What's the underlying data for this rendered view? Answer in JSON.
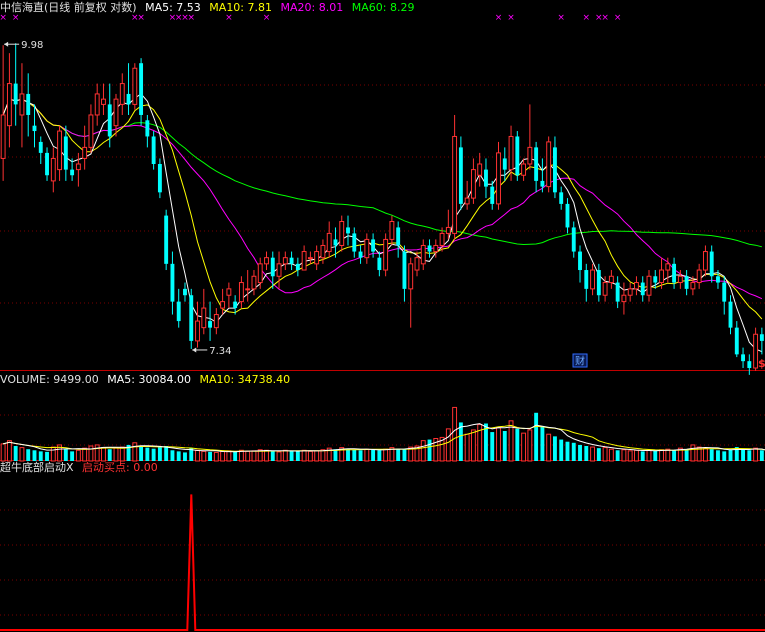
{
  "header": {
    "title": "中信海直(日线 前复权 对数)",
    "ma5": "MA5: 7.53",
    "ma10": "MA10: 7.81",
    "ma20": "MA20: 8.01",
    "ma60": "MA60: 8.29"
  },
  "volume_header": {
    "label": "VOLUME: 9499.00",
    "ma5": "MA5: 30084.00",
    "ma10": "MA10: 34738.40"
  },
  "indicator_header": {
    "name": "超牛底部启动X",
    "value": "启动买点: 0.00"
  },
  "colors": {
    "up": "#ff3232",
    "down": "#00ffff",
    "ma5": "#ffffff",
    "ma10": "#ffff00",
    "ma20": "#ff00ff",
    "ma60": "#00ff00",
    "grid": "#7a0000",
    "axis": "#c00000",
    "signal": "#ff0000"
  },
  "icons": {
    "x_marks": "magenta-x-icon",
    "finance_badge": "财",
    "dividend_badge": "$"
  },
  "chart_data": [
    {
      "type": "candlestick",
      "title": "中信海直(日线 前复权 对数)",
      "log_scale": true,
      "ylim": [
        7.2,
        10.3
      ],
      "annotations": [
        {
          "text": "9.98",
          "candle_index": 0,
          "value": 9.98,
          "kind": "high"
        },
        {
          "text": "7.34",
          "candle_index": 30,
          "value": 7.34,
          "kind": "low"
        }
      ],
      "x_mark_candles": [
        0,
        2,
        21,
        22,
        27,
        28,
        29,
        30,
        36,
        42,
        79,
        81,
        89,
        93,
        95,
        96,
        98
      ],
      "finance_badge_candle": 92,
      "dividend_badge_candle": 121,
      "candles": [
        [
          8.9,
          9.3,
          9.98,
          8.7
        ],
        [
          9.2,
          9.6,
          9.9,
          9.0
        ],
        [
          9.6,
          9.4,
          10.0,
          9.2
        ],
        [
          9.3,
          9.5,
          9.8,
          9.0
        ],
        [
          9.5,
          9.3,
          9.7,
          9.1
        ],
        [
          9.2,
          9.15,
          9.4,
          9.0
        ],
        [
          9.05,
          8.95,
          9.1,
          8.85
        ],
        [
          8.95,
          8.75,
          9.0,
          8.7
        ],
        [
          8.7,
          8.9,
          9.0,
          8.6
        ],
        [
          8.8,
          9.15,
          9.2,
          8.7
        ],
        [
          9.1,
          8.8,
          9.2,
          8.7
        ],
        [
          8.8,
          8.75,
          8.9,
          8.7
        ],
        [
          8.8,
          8.85,
          8.95,
          8.65
        ],
        [
          8.9,
          9.0,
          9.2,
          8.8
        ],
        [
          9.0,
          9.3,
          9.4,
          8.95
        ],
        [
          9.3,
          9.5,
          9.6,
          9.2
        ],
        [
          9.4,
          9.45,
          9.6,
          9.3
        ],
        [
          9.4,
          9.1,
          9.6,
          9.0
        ],
        [
          9.2,
          9.45,
          9.5,
          9.1
        ],
        [
          9.4,
          9.6,
          9.7,
          9.3
        ],
        [
          9.5,
          9.4,
          9.8,
          9.3
        ],
        [
          9.4,
          9.75,
          9.8,
          9.35
        ],
        [
          9.8,
          9.3,
          9.85,
          9.2
        ],
        [
          9.25,
          9.1,
          9.3,
          9.0
        ],
        [
          9.1,
          8.85,
          9.15,
          8.8
        ],
        [
          8.85,
          8.6,
          8.9,
          8.55
        ],
        [
          8.4,
          8.0,
          8.45,
          7.95
        ],
        [
          8.0,
          7.7,
          8.1,
          7.6
        ],
        [
          7.7,
          7.55,
          7.8,
          7.5
        ],
        [
          7.8,
          7.75,
          7.85,
          7.7
        ],
        [
          7.75,
          7.4,
          7.8,
          7.34
        ],
        [
          7.4,
          7.55,
          7.7,
          7.35
        ],
        [
          7.5,
          7.65,
          7.8,
          7.45
        ],
        [
          7.55,
          7.5,
          7.7,
          7.4
        ],
        [
          7.5,
          7.6,
          7.65,
          7.45
        ],
        [
          7.65,
          7.7,
          7.8,
          7.6
        ],
        [
          7.75,
          7.8,
          7.85,
          7.65
        ],
        [
          7.7,
          7.65,
          7.75,
          7.6
        ],
        [
          7.7,
          7.85,
          7.9,
          7.65
        ],
        [
          7.8,
          7.8,
          7.95,
          7.7
        ],
        [
          7.8,
          7.9,
          7.95,
          7.75
        ],
        [
          7.85,
          8.0,
          8.05,
          7.8
        ],
        [
          8.0,
          8.05,
          8.1,
          7.95
        ],
        [
          8.05,
          7.9,
          8.1,
          7.8
        ],
        [
          7.9,
          8.0,
          8.1,
          7.8
        ],
        [
          8.0,
          8.05,
          8.1,
          7.95
        ],
        [
          8.05,
          8.0,
          8.1,
          7.95
        ],
        [
          8.0,
          7.95,
          8.05,
          7.9
        ],
        [
          7.95,
          8.1,
          8.15,
          7.95
        ],
        [
          8.05,
          8.05,
          8.1,
          8.0
        ],
        [
          8.0,
          8.1,
          8.15,
          7.95
        ],
        [
          8.05,
          8.15,
          8.2,
          8.0
        ],
        [
          8.1,
          8.25,
          8.35,
          8.05
        ],
        [
          8.2,
          8.15,
          8.3,
          8.05
        ],
        [
          8.15,
          8.35,
          8.4,
          8.1
        ],
        [
          8.3,
          8.25,
          8.4,
          8.15
        ],
        [
          8.25,
          8.1,
          8.3,
          8.05
        ],
        [
          8.1,
          8.05,
          8.15,
          8.0
        ],
        [
          8.05,
          8.2,
          8.25,
          8.0
        ],
        [
          8.2,
          8.1,
          8.25,
          8.05
        ],
        [
          8.05,
          7.95,
          8.1,
          7.9
        ],
        [
          7.95,
          8.2,
          8.25,
          7.9
        ],
        [
          8.2,
          8.35,
          8.4,
          8.15
        ],
        [
          8.3,
          8.15,
          8.35,
          8.05
        ],
        [
          8.1,
          7.8,
          8.15,
          7.7
        ],
        [
          7.8,
          8.0,
          8.05,
          7.5
        ],
        [
          7.95,
          8.05,
          8.1,
          7.9
        ],
        [
          8.0,
          8.15,
          8.2,
          7.95
        ],
        [
          8.15,
          8.1,
          8.2,
          8.05
        ],
        [
          8.1,
          8.15,
          8.2,
          8.05
        ],
        [
          8.15,
          8.25,
          8.3,
          8.1
        ],
        [
          8.25,
          8.3,
          8.45,
          8.2
        ],
        [
          8.25,
          9.1,
          9.3,
          8.2
        ],
        [
          9.0,
          8.5,
          9.1,
          8.45
        ],
        [
          8.5,
          8.55,
          8.7,
          8.45
        ],
        [
          8.55,
          8.8,
          8.9,
          8.5
        ],
        [
          8.75,
          8.85,
          8.95,
          8.65
        ],
        [
          8.8,
          8.65,
          8.9,
          8.55
        ],
        [
          8.65,
          8.5,
          8.7,
          8.45
        ],
        [
          8.5,
          8.95,
          9.05,
          8.45
        ],
        [
          8.9,
          8.8,
          9.0,
          8.7
        ],
        [
          8.8,
          9.1,
          9.2,
          8.7
        ],
        [
          9.1,
          8.75,
          9.15,
          8.7
        ],
        [
          8.75,
          8.85,
          8.9,
          8.7
        ],
        [
          8.85,
          9.0,
          9.4,
          8.8
        ],
        [
          9.0,
          8.7,
          9.05,
          8.6
        ],
        [
          8.7,
          8.65,
          8.9,
          8.6
        ],
        [
          8.65,
          9.05,
          9.1,
          8.6
        ],
        [
          9.0,
          8.6,
          9.1,
          8.55
        ],
        [
          8.6,
          8.5,
          8.65,
          8.45
        ],
        [
          8.5,
          8.3,
          8.55,
          8.25
        ],
        [
          8.3,
          8.1,
          8.35,
          8.05
        ],
        [
          8.1,
          7.95,
          8.15,
          7.85
        ],
        [
          7.95,
          7.8,
          8.0,
          7.7
        ],
        [
          7.8,
          7.95,
          8.0,
          7.75
        ],
        [
          7.95,
          7.75,
          8.0,
          7.7
        ],
        [
          7.75,
          7.85,
          7.9,
          7.7
        ],
        [
          7.85,
          7.9,
          7.95,
          7.8
        ],
        [
          7.85,
          7.7,
          7.9,
          7.65
        ],
        [
          7.7,
          7.75,
          7.85,
          7.6
        ],
        [
          7.75,
          7.8,
          7.85,
          7.7
        ],
        [
          7.8,
          7.85,
          7.9,
          7.75
        ],
        [
          7.85,
          7.75,
          7.9,
          7.7
        ],
        [
          7.75,
          7.9,
          7.95,
          7.7
        ],
        [
          7.9,
          7.85,
          7.95,
          7.8
        ],
        [
          7.85,
          7.95,
          8.05,
          7.8
        ],
        [
          7.95,
          8.0,
          8.05,
          7.85
        ],
        [
          8.0,
          7.85,
          8.05,
          7.8
        ],
        [
          7.85,
          7.9,
          7.95,
          7.8
        ],
        [
          7.9,
          7.8,
          7.95,
          7.75
        ],
        [
          7.8,
          7.85,
          7.9,
          7.75
        ],
        [
          7.85,
          7.95,
          8.0,
          7.8
        ],
        [
          7.95,
          8.1,
          8.15,
          7.9
        ],
        [
          8.1,
          7.9,
          8.15,
          7.85
        ],
        [
          7.9,
          7.85,
          7.95,
          7.8
        ],
        [
          7.85,
          7.7,
          7.9,
          7.6
        ],
        [
          7.7,
          7.5,
          7.75,
          7.45
        ],
        [
          7.5,
          7.3,
          7.55,
          7.28
        ],
        [
          7.3,
          7.25,
          7.35,
          7.2
        ],
        [
          7.25,
          7.2,
          7.3,
          7.15
        ],
        [
          7.2,
          7.45,
          7.5,
          7.18
        ],
        [
          7.45,
          7.4,
          7.5,
          7.3
        ]
      ],
      "ma5_last": 7.53,
      "ma10_last": 7.81,
      "ma20_last": 8.01,
      "ma60_last": 8.29
    },
    {
      "type": "bar",
      "title": "VOLUME: 9499.00",
      "ylim": [
        0,
        140000
      ],
      "values": [
        32000,
        38000,
        28000,
        25000,
        22000,
        20000,
        18000,
        17000,
        26000,
        30000,
        22000,
        18000,
        20000,
        24000,
        28000,
        30000,
        25000,
        22000,
        24000,
        26000,
        30000,
        34000,
        28000,
        25000,
        23000,
        26000,
        28000,
        20000,
        18000,
        16000,
        24000,
        20000,
        18000,
        17000,
        16000,
        18000,
        19000,
        17000,
        20000,
        18000,
        19000,
        21000,
        20000,
        18000,
        17000,
        20000,
        19000,
        18000,
        20000,
        18000,
        19000,
        21000,
        24000,
        22000,
        25000,
        23000,
        21000,
        20000,
        22000,
        21000,
        20000,
        22000,
        25000,
        23000,
        22000,
        26000,
        28000,
        38000,
        40000,
        42000,
        44000,
        60000,
        100000,
        72000,
        50000,
        58000,
        68000,
        70000,
        54000,
        62000,
        56000,
        75000,
        60000,
        52000,
        58000,
        90000,
        64000,
        50000,
        46000,
        40000,
        36000,
        34000,
        30000,
        28000,
        26000,
        24000,
        25000,
        22000,
        20000,
        21000,
        19000,
        20000,
        18000,
        20000,
        19000,
        21000,
        22000,
        20000,
        24000,
        22000,
        30000,
        26000,
        24000,
        22000,
        20000,
        18000,
        21000,
        26000,
        22000,
        20000,
        24000,
        20000,
        9499
      ],
      "ma5_last": 30084.0,
      "ma10_last": 34738.4
    },
    {
      "type": "line",
      "title": "超牛底部启动X",
      "series": [
        {
          "name": "启动买点",
          "spike_index": 30,
          "spike_value": 1,
          "last_value": 0.0
        }
      ],
      "ylim": [
        0,
        1.15
      ]
    }
  ]
}
